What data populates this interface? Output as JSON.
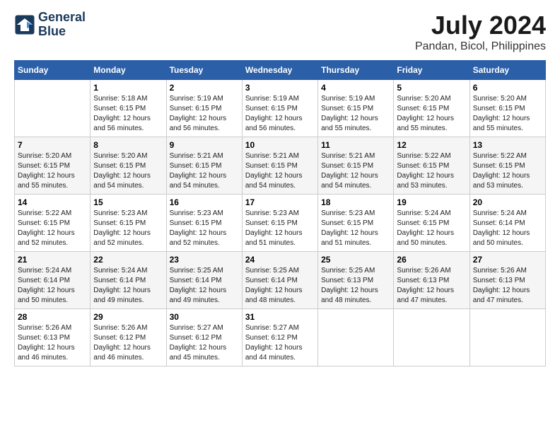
{
  "header": {
    "logo_line1": "General",
    "logo_line2": "Blue",
    "month_year": "July 2024",
    "location": "Pandan, Bicol, Philippines"
  },
  "days_of_week": [
    "Sunday",
    "Monday",
    "Tuesday",
    "Wednesday",
    "Thursday",
    "Friday",
    "Saturday"
  ],
  "weeks": [
    [
      {
        "day": "",
        "info": ""
      },
      {
        "day": "1",
        "info": "Sunrise: 5:18 AM\nSunset: 6:15 PM\nDaylight: 12 hours\nand 56 minutes."
      },
      {
        "day": "2",
        "info": "Sunrise: 5:19 AM\nSunset: 6:15 PM\nDaylight: 12 hours\nand 56 minutes."
      },
      {
        "day": "3",
        "info": "Sunrise: 5:19 AM\nSunset: 6:15 PM\nDaylight: 12 hours\nand 56 minutes."
      },
      {
        "day": "4",
        "info": "Sunrise: 5:19 AM\nSunset: 6:15 PM\nDaylight: 12 hours\nand 55 minutes."
      },
      {
        "day": "5",
        "info": "Sunrise: 5:20 AM\nSunset: 6:15 PM\nDaylight: 12 hours\nand 55 minutes."
      },
      {
        "day": "6",
        "info": "Sunrise: 5:20 AM\nSunset: 6:15 PM\nDaylight: 12 hours\nand 55 minutes."
      }
    ],
    [
      {
        "day": "7",
        "info": "Sunrise: 5:20 AM\nSunset: 6:15 PM\nDaylight: 12 hours\nand 55 minutes."
      },
      {
        "day": "8",
        "info": "Sunrise: 5:20 AM\nSunset: 6:15 PM\nDaylight: 12 hours\nand 54 minutes."
      },
      {
        "day": "9",
        "info": "Sunrise: 5:21 AM\nSunset: 6:15 PM\nDaylight: 12 hours\nand 54 minutes."
      },
      {
        "day": "10",
        "info": "Sunrise: 5:21 AM\nSunset: 6:15 PM\nDaylight: 12 hours\nand 54 minutes."
      },
      {
        "day": "11",
        "info": "Sunrise: 5:21 AM\nSunset: 6:15 PM\nDaylight: 12 hours\nand 54 minutes."
      },
      {
        "day": "12",
        "info": "Sunrise: 5:22 AM\nSunset: 6:15 PM\nDaylight: 12 hours\nand 53 minutes."
      },
      {
        "day": "13",
        "info": "Sunrise: 5:22 AM\nSunset: 6:15 PM\nDaylight: 12 hours\nand 53 minutes."
      }
    ],
    [
      {
        "day": "14",
        "info": "Sunrise: 5:22 AM\nSunset: 6:15 PM\nDaylight: 12 hours\nand 52 minutes."
      },
      {
        "day": "15",
        "info": "Sunrise: 5:23 AM\nSunset: 6:15 PM\nDaylight: 12 hours\nand 52 minutes."
      },
      {
        "day": "16",
        "info": "Sunrise: 5:23 AM\nSunset: 6:15 PM\nDaylight: 12 hours\nand 52 minutes."
      },
      {
        "day": "17",
        "info": "Sunrise: 5:23 AM\nSunset: 6:15 PM\nDaylight: 12 hours\nand 51 minutes."
      },
      {
        "day": "18",
        "info": "Sunrise: 5:23 AM\nSunset: 6:15 PM\nDaylight: 12 hours\nand 51 minutes."
      },
      {
        "day": "19",
        "info": "Sunrise: 5:24 AM\nSunset: 6:15 PM\nDaylight: 12 hours\nand 50 minutes."
      },
      {
        "day": "20",
        "info": "Sunrise: 5:24 AM\nSunset: 6:14 PM\nDaylight: 12 hours\nand 50 minutes."
      }
    ],
    [
      {
        "day": "21",
        "info": "Sunrise: 5:24 AM\nSunset: 6:14 PM\nDaylight: 12 hours\nand 50 minutes."
      },
      {
        "day": "22",
        "info": "Sunrise: 5:24 AM\nSunset: 6:14 PM\nDaylight: 12 hours\nand 49 minutes."
      },
      {
        "day": "23",
        "info": "Sunrise: 5:25 AM\nSunset: 6:14 PM\nDaylight: 12 hours\nand 49 minutes."
      },
      {
        "day": "24",
        "info": "Sunrise: 5:25 AM\nSunset: 6:14 PM\nDaylight: 12 hours\nand 48 minutes."
      },
      {
        "day": "25",
        "info": "Sunrise: 5:25 AM\nSunset: 6:13 PM\nDaylight: 12 hours\nand 48 minutes."
      },
      {
        "day": "26",
        "info": "Sunrise: 5:26 AM\nSunset: 6:13 PM\nDaylight: 12 hours\nand 47 minutes."
      },
      {
        "day": "27",
        "info": "Sunrise: 5:26 AM\nSunset: 6:13 PM\nDaylight: 12 hours\nand 47 minutes."
      }
    ],
    [
      {
        "day": "28",
        "info": "Sunrise: 5:26 AM\nSunset: 6:13 PM\nDaylight: 12 hours\nand 46 minutes."
      },
      {
        "day": "29",
        "info": "Sunrise: 5:26 AM\nSunset: 6:12 PM\nDaylight: 12 hours\nand 46 minutes."
      },
      {
        "day": "30",
        "info": "Sunrise: 5:27 AM\nSunset: 6:12 PM\nDaylight: 12 hours\nand 45 minutes."
      },
      {
        "day": "31",
        "info": "Sunrise: 5:27 AM\nSunset: 6:12 PM\nDaylight: 12 hours\nand 44 minutes."
      },
      {
        "day": "",
        "info": ""
      },
      {
        "day": "",
        "info": ""
      },
      {
        "day": "",
        "info": ""
      }
    ]
  ]
}
